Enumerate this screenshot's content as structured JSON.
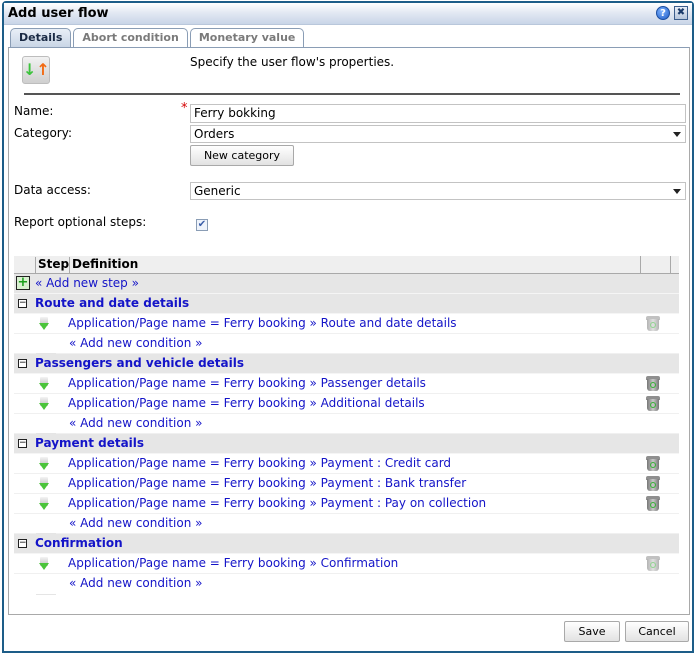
{
  "window": {
    "title": "Add user flow",
    "help_icon": "?",
    "close_icon": "✖"
  },
  "tabs": [
    {
      "label": "Details",
      "active": true
    },
    {
      "label": "Abort condition",
      "active": false
    },
    {
      "label": "Monetary value",
      "active": false
    }
  ],
  "header": {
    "icon": "user-flow-icon",
    "description": "Specify the user flow's properties."
  },
  "form": {
    "name_label": "Name:",
    "name_required_marker": "*",
    "name_value": "Ferry bokking",
    "category_label": "Category:",
    "category_value": "Orders",
    "new_category_button": "New category",
    "data_access_label": "Data access:",
    "data_access_value": "Generic",
    "report_optional_label": "Report optional steps:",
    "report_optional_checked": true,
    "checkmark": "✔"
  },
  "grid": {
    "columns": {
      "step": "Step",
      "definition": "Definition"
    },
    "add_step_label": "« Add new step »",
    "add_condition_label": "« Add new condition »",
    "groups": [
      {
        "title": "Route and date details",
        "steps": [
          {
            "definition": "Application/Page name = Ferry booking » Route and date details",
            "delete_enabled": false
          }
        ]
      },
      {
        "title": "Passengers and vehicle details",
        "steps": [
          {
            "definition": "Application/Page name = Ferry booking » Passenger details",
            "delete_enabled": true
          },
          {
            "definition": "Application/Page name = Ferry booking » Additional details",
            "delete_enabled": true
          }
        ]
      },
      {
        "title": "Payment details",
        "steps": [
          {
            "definition": "Application/Page name = Ferry booking » Payment : Credit card",
            "delete_enabled": true
          },
          {
            "definition": "Application/Page name = Ferry booking » Payment : Bank transfer",
            "delete_enabled": true
          },
          {
            "definition": "Application/Page name = Ferry booking » Payment : Pay on collection",
            "delete_enabled": true
          }
        ]
      },
      {
        "title": "Confirmation",
        "steps": [
          {
            "definition": "Application/Page name = Ferry booking » Confirmation",
            "delete_enabled": false
          }
        ]
      }
    ]
  },
  "footer": {
    "save_label": "Save",
    "cancel_label": "Cancel"
  },
  "colors": {
    "frame": "#1d5d88",
    "link": "#1414c8",
    "required": "#d40000"
  }
}
